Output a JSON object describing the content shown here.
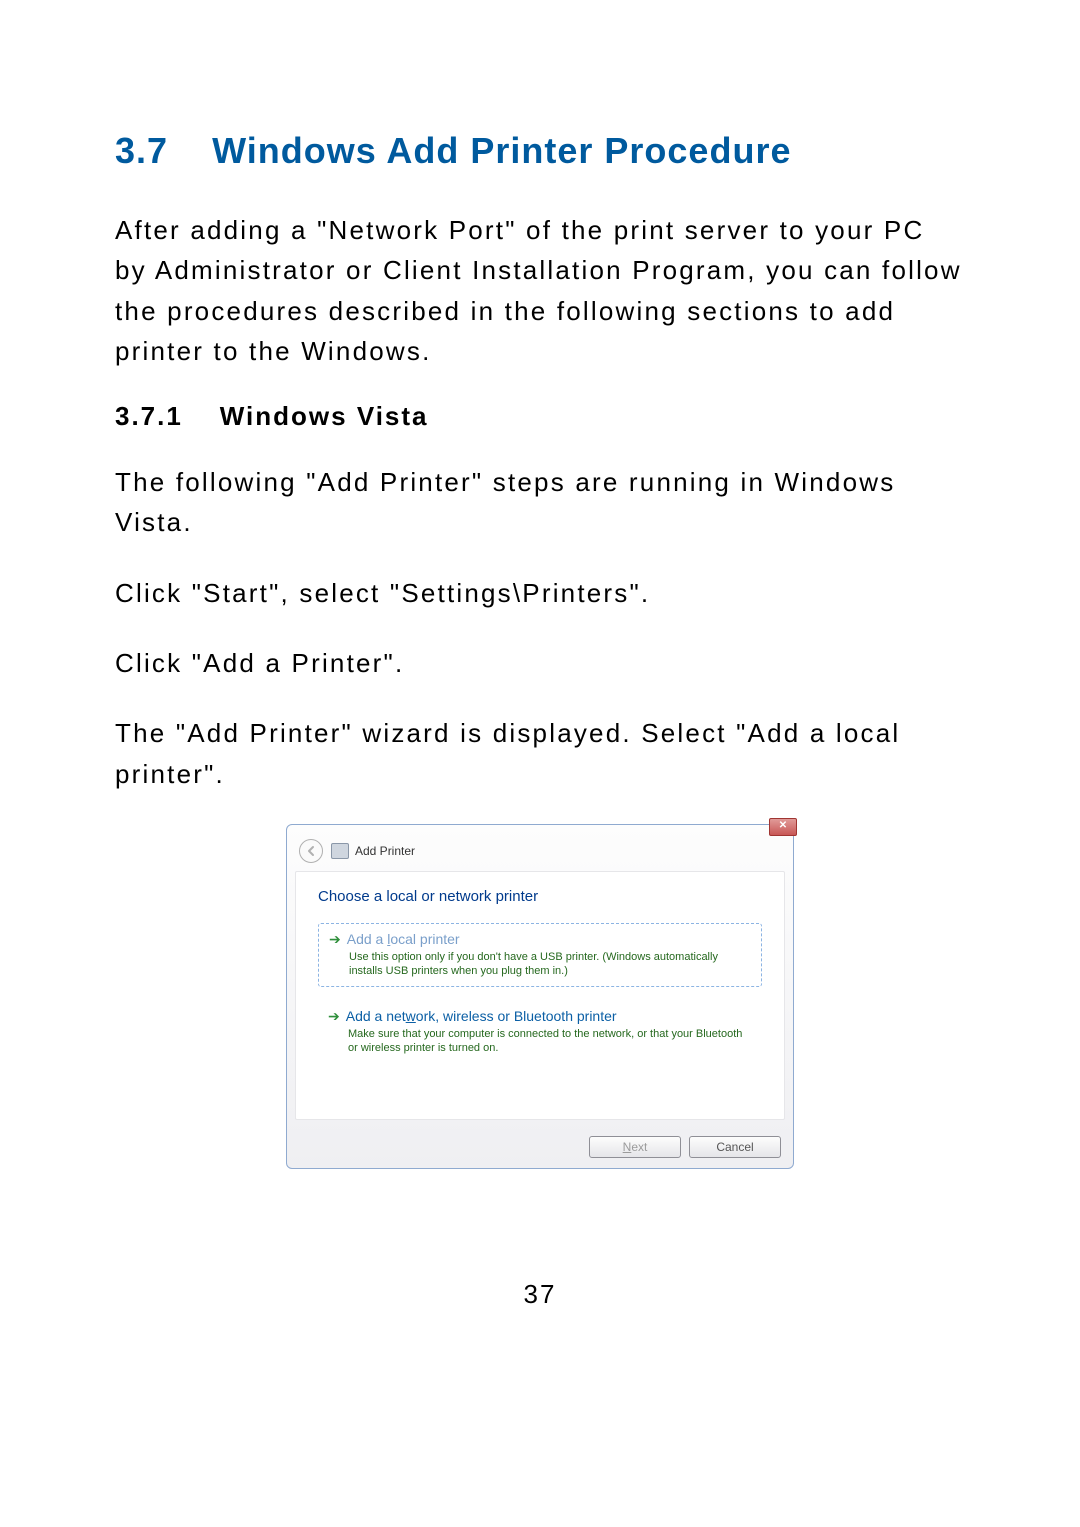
{
  "heading": {
    "number": "3.7",
    "title": "Windows Add Printer Procedure"
  },
  "intro": "After adding a \"Network Port\" of the print server to your PC by Administrator or Client Installation Program, you can follow the procedures described in the following sections to add printer to the Windows.",
  "subheading": {
    "number": "3.7.1",
    "title": "Windows Vista"
  },
  "para2": " The following \"Add Printer\" steps are running in Windows Vista.",
  "para3": "Click \"Start\", select \"Settings\\Printers\".",
  "para4": "Click \"Add a Printer\".",
  "para5": "The \"Add Printer\" wizard is displayed. Select \"Add a local printer\".",
  "dialog": {
    "title": "Add Printer",
    "subhead": "Choose a local or network printer",
    "opt1_prefix": "Add a ",
    "opt1_ul": "l",
    "opt1_suffix": "ocal printer",
    "opt1_desc": "Use this option only if you don't have a USB printer. (Windows automatically installs USB printers when you plug them in.)",
    "opt2_prefix": "Add a net",
    "opt2_ul": "w",
    "opt2_suffix": "ork, wireless or Bluetooth printer",
    "opt2_desc": "Make sure that your computer is connected to the network, or that your Bluetooth or wireless printer is turned on.",
    "next_pre": "N",
    "next_post": "ext",
    "cancel": "Cancel"
  },
  "pagenum": "37"
}
